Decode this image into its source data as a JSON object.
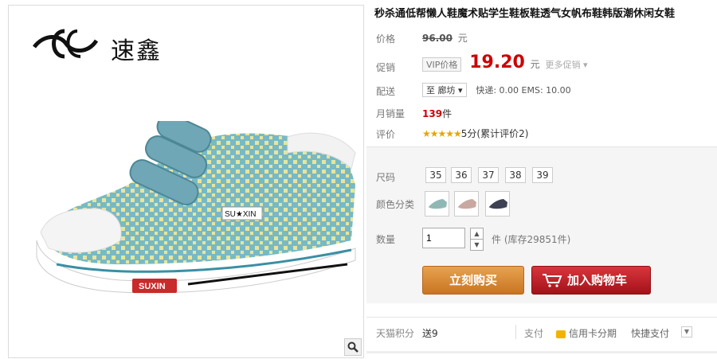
{
  "brand": {
    "text": "速鑫",
    "shoe_label": "SUXIN",
    "tongue_label": "SU★XIN"
  },
  "product": {
    "title": "秒杀通低帮懒人鞋魔术贴学生鞋板鞋透气女帆布鞋韩版潮休闲女鞋"
  },
  "labels": {
    "price": "价格",
    "promo": "促销",
    "delivery": "配送",
    "monthly_sales": "月销量",
    "rating": "评价",
    "size": "尺码",
    "color": "颜色分类",
    "quantity": "数量",
    "points": "天猫积分",
    "pay": "支付",
    "installment": "信用卡分期",
    "quickpay": "快捷支付"
  },
  "price": {
    "original": "96.00",
    "unit": "元"
  },
  "promo": {
    "tag": "VIP价格",
    "price": "19.20",
    "unit": "元",
    "more": "更多促销"
  },
  "delivery": {
    "destination": "至 廊坊",
    "shipping": "快递: 0.00 EMS: 10.00"
  },
  "sales": {
    "count": "139",
    "unit": "件"
  },
  "rating": {
    "stars": "★★★★★",
    "score": "5分(累计评价2)"
  },
  "sizes": [
    "35",
    "36",
    "37",
    "38",
    "39"
  ],
  "swatches": [
    {
      "name": "color-swatch-blue",
      "color": "#8fb8b5"
    },
    {
      "name": "color-swatch-pink",
      "color": "#c9a8a2"
    },
    {
      "name": "color-swatch-navy",
      "color": "#3d4153"
    }
  ],
  "quantity": {
    "value": "1",
    "stock": "件 (库存29851件)"
  },
  "buttons": {
    "buy_now": "立刻购买",
    "add_to_cart": "加入购物车"
  },
  "points": {
    "value": "送9"
  },
  "colors": {
    "price_red": "#cc0000",
    "buy_orange": "#d4822d",
    "cart_red": "#c0202a"
  },
  "icons": [
    "zoom-icon",
    "cart-icon",
    "credit-card-icon",
    "chevron-down-icon",
    "brand-logo-icon"
  ]
}
